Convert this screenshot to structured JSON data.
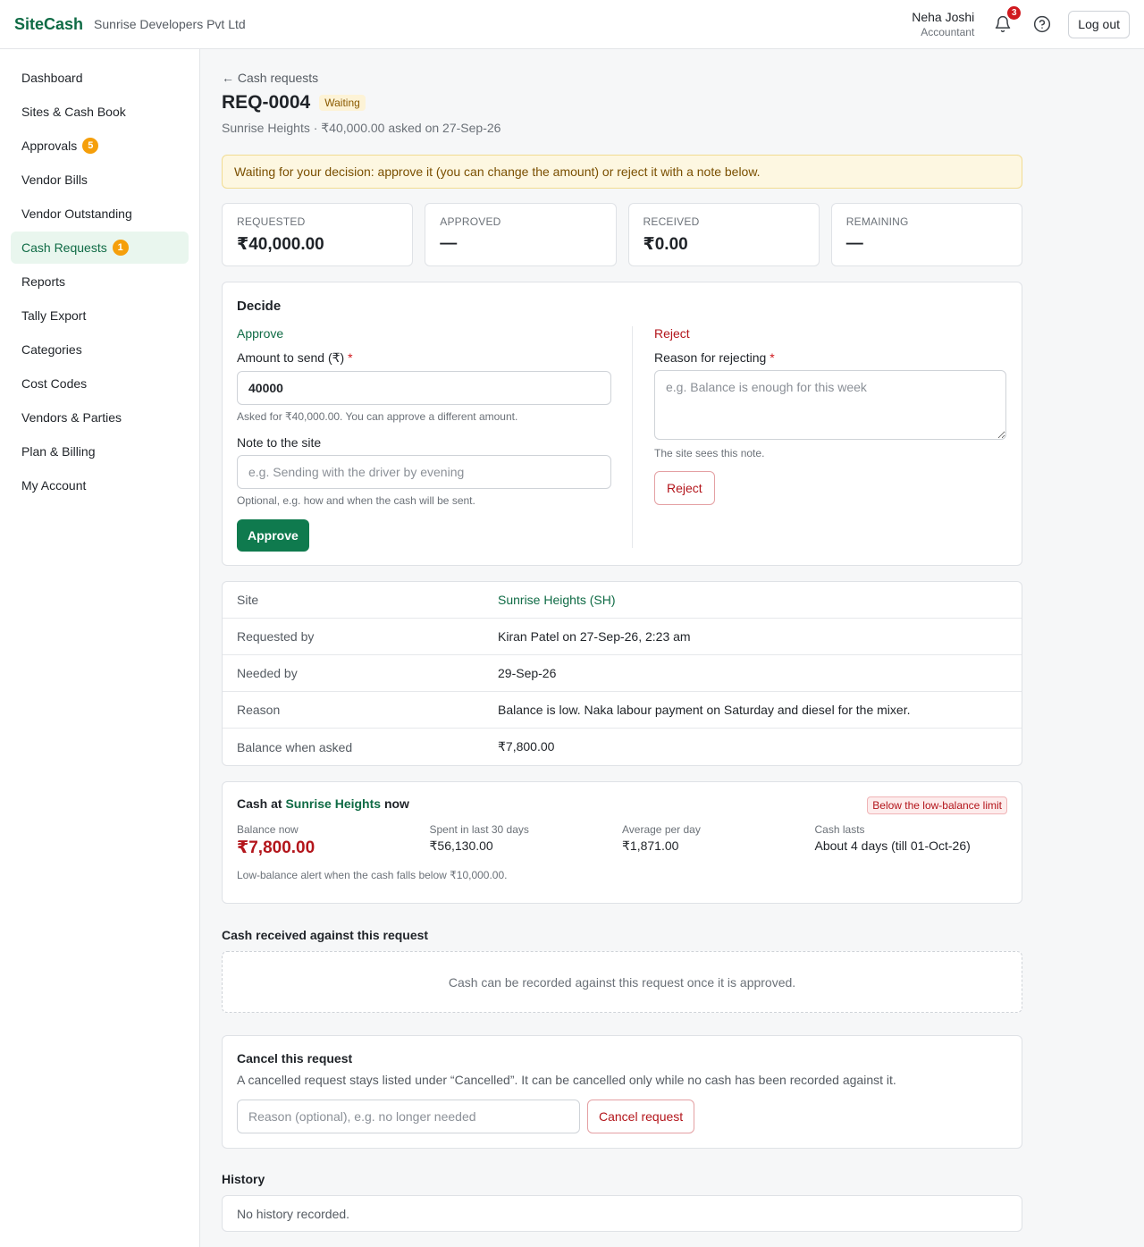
{
  "header": {
    "brand": "SiteCash",
    "company": "Sunrise Developers Pvt Ltd",
    "user_name": "Neha Joshi",
    "user_role": "Accountant",
    "notification_count": "3",
    "logout_label": "Log out"
  },
  "sidebar": {
    "items": [
      {
        "label": "Dashboard"
      },
      {
        "label": "Sites & Cash Book"
      },
      {
        "label": "Approvals",
        "badge": "5"
      },
      {
        "label": "Vendor Bills"
      },
      {
        "label": "Vendor Outstanding"
      },
      {
        "label": "Cash Requests",
        "badge": "1",
        "active": true
      },
      {
        "label": "Reports"
      },
      {
        "label": "Tally Export"
      },
      {
        "label": "Categories"
      },
      {
        "label": "Cost Codes"
      },
      {
        "label": "Vendors & Parties"
      },
      {
        "label": "Plan & Billing"
      },
      {
        "label": "My Account"
      }
    ]
  },
  "page": {
    "back_link": "← Cash requests",
    "title": "REQ-0004",
    "status": "Waiting",
    "subtitle": "Sunrise Heights · ₹40,000.00 asked on 27-Sep-26",
    "alert": "Waiting for your decision: approve it (you can change the amount) or reject it with a note below."
  },
  "stats": [
    {
      "label": "REQUESTED",
      "value": "₹40,000.00"
    },
    {
      "label": "APPROVED",
      "value": "—"
    },
    {
      "label": "RECEIVED",
      "value": "₹0.00"
    },
    {
      "label": "REMAINING",
      "value": "—"
    }
  ],
  "decide": {
    "title": "Decide",
    "approve": {
      "heading": "Approve",
      "amount_label": "Amount to send (₹)",
      "required_mark": "*",
      "amount_value": "40000",
      "amount_hint": "Asked for ₹40,000.00. You can approve a different amount.",
      "note_label": "Note to the site",
      "note_placeholder": "e.g. Sending with the driver by evening",
      "note_hint": "Optional, e.g. how and when the cash will be sent.",
      "button": "Approve"
    },
    "reject": {
      "heading": "Reject",
      "reason_label": "Reason for rejecting",
      "required_mark": "*",
      "reason_placeholder": "e.g. Balance is enough for this week",
      "reason_hint": "The site sees this note.",
      "button": "Reject"
    }
  },
  "details": [
    {
      "key": "Site",
      "value": "Sunrise Heights (SH)"
    },
    {
      "key": "Requested by",
      "value": "Kiran Patel on 27-Sep-26, 2:23 am"
    },
    {
      "key": "Needed by",
      "value": "29-Sep-26"
    },
    {
      "key": "Reason",
      "value": "Balance is low. Naka labour payment on Saturday and diesel for the mixer."
    },
    {
      "key": "Balance when asked",
      "value": "₹7,800.00"
    }
  ],
  "cash_now": {
    "title_prefix": "Cash at",
    "site": "Sunrise Heights",
    "title_suffix": "now",
    "limit_badge": "Below the low-balance limit",
    "metrics": [
      {
        "label": "Balance now",
        "value": "₹7,800.00"
      },
      {
        "label": "Spent in last 30 days",
        "value": "₹56,130.00"
      },
      {
        "label": "Average per day",
        "value": "₹1,871.00"
      },
      {
        "label": "Cash lasts",
        "value": "About 4 days (till 01-Oct-26)"
      }
    ],
    "note": "Low-balance alert when the cash falls below ₹10,000.00."
  },
  "received": {
    "title": "Cash received against this request",
    "empty": "Cash can be recorded against this request once it is approved."
  },
  "cancel": {
    "title": "Cancel this request",
    "desc": "A cancelled request stays listed under “Cancelled”. It can be cancelled only while no cash has been recorded against it.",
    "placeholder": "Reason (optional), e.g. no longer needed",
    "button": "Cancel request"
  },
  "history": {
    "title": "History",
    "empty": "No history recorded."
  },
  "icons": {
    "bell": "bell-icon",
    "help": "help-circle-icon"
  },
  "colors": {
    "brand": "#0f6b45",
    "danger": "#b3151b",
    "warning_bg": "#fdf7e1"
  }
}
